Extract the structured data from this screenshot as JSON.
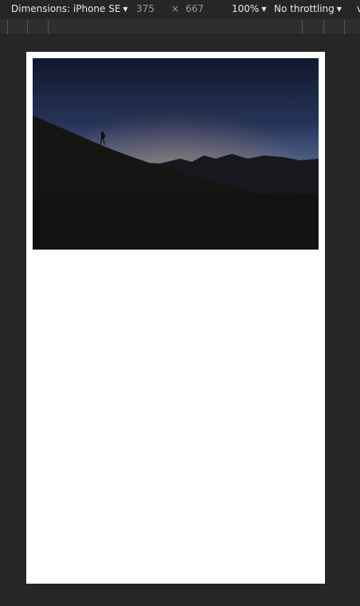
{
  "toolbar": {
    "dimensions_label": "Dimensions: iPhone SE",
    "width": "375",
    "times": "×",
    "height": "667",
    "zoom": "100%",
    "throttling": "No throttling",
    "more": "v"
  },
  "page": {
    "image": {
      "icon": "landscape-photo-icon",
      "description_colors": {
        "sky_top": "#121a2e",
        "sky_mid": "#3b4a72",
        "horizon_glow": "#f08a2a",
        "ground": "#141414"
      }
    }
  }
}
